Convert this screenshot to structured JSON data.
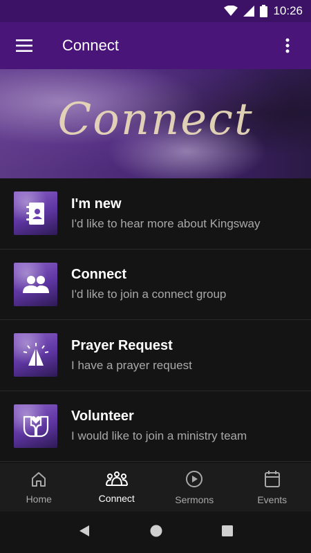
{
  "status_bar": {
    "time": "10:26",
    "icons": [
      "wifi-icon",
      "signal-icon",
      "battery-icon"
    ]
  },
  "app_bar": {
    "title": "Connect",
    "menu_icon": "hamburger-menu-icon",
    "more_icon": "more-vertical-icon"
  },
  "hero": {
    "title": "Connect"
  },
  "list": {
    "items": [
      {
        "title": "I'm new",
        "subtitle": "I'd like to hear more about Kingsway",
        "icon": "contact-book-icon"
      },
      {
        "title": "Connect",
        "subtitle": "I'd like to join a connect group",
        "icon": "group-icon"
      },
      {
        "title": "Prayer Request",
        "subtitle": "I have a prayer request",
        "icon": "praying-hands-icon"
      },
      {
        "title": "Volunteer",
        "subtitle": "I would like to join a ministry team",
        "icon": "raised-hands-heart-icon"
      }
    ]
  },
  "bottom_nav": {
    "items": [
      {
        "label": "Home",
        "icon": "home-icon",
        "active": false
      },
      {
        "label": "Connect",
        "icon": "people-icon",
        "active": true
      },
      {
        "label": "Sermons",
        "icon": "play-circle-icon",
        "active": false
      },
      {
        "label": "Events",
        "icon": "calendar-icon",
        "active": false
      }
    ]
  },
  "system_nav": {
    "icons": [
      "back-icon",
      "home-circle-icon",
      "recents-icon"
    ]
  },
  "colors": {
    "app_bar": "#4a1578",
    "status_bar": "#3c1266",
    "background": "#141414",
    "accent_text": "#e8d8b8"
  }
}
